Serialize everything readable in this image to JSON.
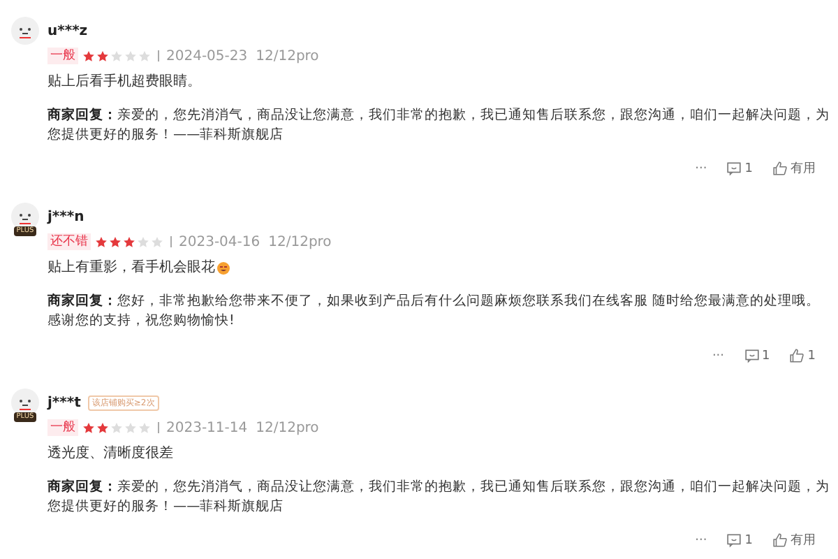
{
  "reviews": [
    {
      "user": "u***z",
      "rating_label": "一般",
      "stars": 2,
      "date": "2024-05-23",
      "model": "12/12pro",
      "text": "贴上后看手机超费眼睛。",
      "emoji": false,
      "reply_label": "商家回复：",
      "reply": "亲爱的，您先消消气，商品没让您满意，我们非常的抱歉，我已通知售后联系您，跟您沟通，咱们一起解决问题，为您提供更好的服务！——菲科斯旗舰店",
      "more": "···",
      "comments": "1",
      "likes": "有用"
    },
    {
      "user": "j***n",
      "plus_badge": "PLUS",
      "rating_label": "还不错",
      "stars": 3,
      "date": "2023-04-16",
      "model": "12/12pro",
      "text": "贴上有重影，看手机会眼花",
      "emoji": true,
      "reply_label": "商家回复：",
      "reply": "您好，非常抱歉给您带来不便了，如果收到产品后有什么问题麻烦您联系我们在线客服 随时给您最满意的处理哦。感谢您的支持，祝您购物愉快!",
      "more": "···",
      "comments": "1",
      "likes": "1"
    },
    {
      "user": "j***t",
      "plus_badge": "PLUS",
      "badge": "该店铺购买≥2次",
      "rating_label": "一般",
      "stars": 2,
      "date": "2023-11-14",
      "model": "12/12pro",
      "text": "透光度、清晰度很差",
      "emoji": false,
      "reply_label": "商家回复：",
      "reply": "亲爱的，您先消消气，商品没让您满意，我们非常的抱歉，我已通知售后联系您，跟您沟通，咱们一起解决问题，为您提供更好的服务！——菲科斯旗舰店",
      "more": "···",
      "comments": "1",
      "likes": "有用"
    }
  ]
}
